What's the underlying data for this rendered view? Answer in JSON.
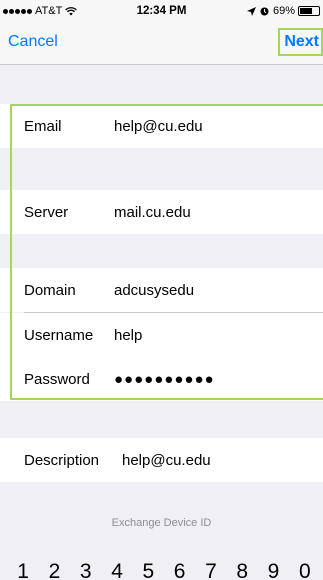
{
  "status_bar": {
    "carrier": "AT&T",
    "time": "12:34 PM",
    "battery_percent": "69%",
    "battery_level": 0.69,
    "icons": [
      "signal-dots",
      "wifi-icon",
      "location-icon",
      "alarm-icon",
      "battery-icon"
    ]
  },
  "nav": {
    "cancel_label": "Cancel",
    "next_label": "Next"
  },
  "form": {
    "email": {
      "label": "Email",
      "value": "help@cu.edu"
    },
    "server": {
      "label": "Server",
      "value": "mail.cu.edu"
    },
    "domain": {
      "label": "Domain",
      "value": "adcusysedu"
    },
    "username": {
      "label": "Username",
      "value": "help"
    },
    "password": {
      "label": "Password",
      "value": "●●●●●●●●●●"
    },
    "description": {
      "label": "Description",
      "value": "help@cu.edu"
    }
  },
  "footer": {
    "device_id_label": "Exchange Device ID"
  },
  "keyboard": {
    "keys": [
      "1",
      "2",
      "3",
      "4",
      "5",
      "6",
      "7",
      "8",
      "9",
      "0"
    ]
  },
  "colors": {
    "accent": "#007aff",
    "highlight": "#a4d65e",
    "background": "#efeff4"
  }
}
